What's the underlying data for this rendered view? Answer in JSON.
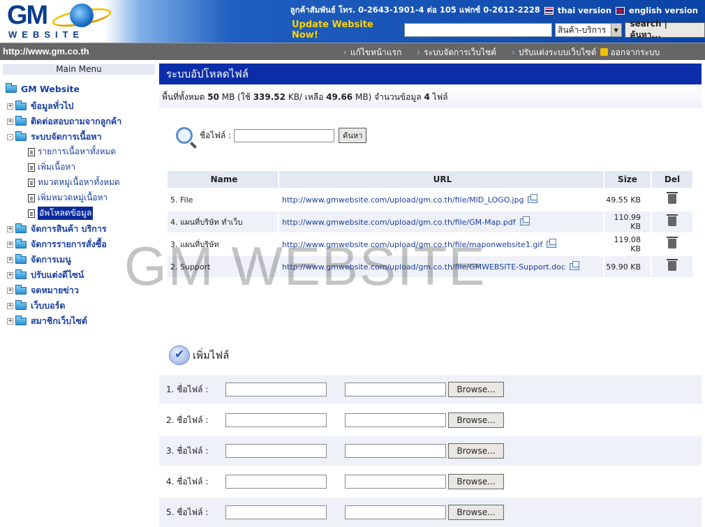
{
  "header": {
    "logo_text": "GM",
    "logo_subtext": "WEBSITE",
    "contact": "ลูกค้าสัมพันธ์ โทร. 0-2643-1901-4 ต่อ 105 แฟกซ์ 0-2612-2228",
    "thai_version": "thai version",
    "english_version": "english version",
    "update_label": "Update Website Now!",
    "search_value": "",
    "category_selected": "สินค้า-บริการ",
    "search_button": "search | ค้นหา..."
  },
  "urlbar": {
    "site_url": "http://www.gm.co.th",
    "nav": [
      "แก้ไขหน้าแรก",
      "ระบบจัดการเว็บไซต์",
      "ปรับแต่งระบบเว็บไซต์",
      "ออกจากระบบ"
    ]
  },
  "sidebar": {
    "menu_title": "Main Menu",
    "root": "GM Website",
    "items": [
      {
        "label": "ข้อมูลทั่วไป",
        "expander": "+"
      },
      {
        "label": "ติดต่อสอบถามจากลูกค้า",
        "expander": "+"
      },
      {
        "label": "ระบบจัดการเนื้อหา",
        "expander": "-"
      },
      {
        "label": "จัดการสินค้า บริการ",
        "expander": "+"
      },
      {
        "label": "จัดการรายการสั่งซื้อ",
        "expander": "+"
      },
      {
        "label": "จัดการเมนู",
        "expander": "+"
      },
      {
        "label": "ปรับแต่งดีไซน์",
        "expander": "+"
      },
      {
        "label": "จดหมายข่าว",
        "expander": "+"
      },
      {
        "label": "เว็บบอร์ด",
        "expander": "+"
      },
      {
        "label": "สมาชิกเว็บไซต์",
        "expander": "+"
      }
    ],
    "sub_items": [
      "รายการเนื้อหาทั้งหมด",
      "เพิ่มเนื้อหา",
      "หมวดหมู่เนื้อหาทั้งหมด",
      "เพิ่มหมวดหมู่เนื้อหา",
      "อัพโหลดข้อมูล"
    ]
  },
  "main": {
    "title": "ระบบอัปโหลดไฟล์",
    "quota": {
      "prefix": "พื้นที่ทั้งหมด",
      "total": "50",
      "unit1": "MB (ใช้",
      "used": "339.52",
      "unit2": "KB/ เหลือ",
      "remaining": "49.66",
      "unit3": "MB) จำนวนข้อมูล",
      "count": "4",
      "suffix": "ไฟล์"
    },
    "search": {
      "label": "ชื่อไฟล์ :",
      "value": "",
      "button": "ค้นหา"
    },
    "table": {
      "headers": [
        "Name",
        "URL",
        "Size",
        "Del"
      ],
      "rows": [
        {
          "name": "5.  File",
          "url": "http://www.gmwebsite.com/upload/gm.co.th/file/MID_LOGO.jpg",
          "size": "49.55 KB"
        },
        {
          "name": "4.  แผนที่บริษัท ทำเว็บ",
          "url": "http://www.gmwebsite.com/upload/gm.co.th/file/GM-Map.pdf",
          "size": "110.99 KB"
        },
        {
          "name": "3.  แผนที่บริษัท",
          "url": "http://www.gmwebsite.com/upload/gm.co.th/file/maponwebsite1.gif",
          "size": "119.08 KB"
        },
        {
          "name": "2.  Support",
          "url": "http://www.gmwebsite.com/upload/gm.co.th/file/GMWEBSITE-Support.doc",
          "size": "59.90 KB"
        }
      ]
    },
    "watermark": "GM WEBSITE",
    "add": {
      "title": "เพิ่มไฟล์",
      "rows": [
        {
          "label": "1. ชื่อไฟล์ :",
          "browse": "Browse..."
        },
        {
          "label": "2. ชื่อไฟล์ :",
          "browse": "Browse..."
        },
        {
          "label": "3. ชื่อไฟล์ :",
          "browse": "Browse..."
        },
        {
          "label": "4. ชื่อไฟล์ :",
          "browse": "Browse..."
        },
        {
          "label": "5. ชื่อไฟล์ :",
          "browse": "Browse..."
        }
      ]
    }
  }
}
